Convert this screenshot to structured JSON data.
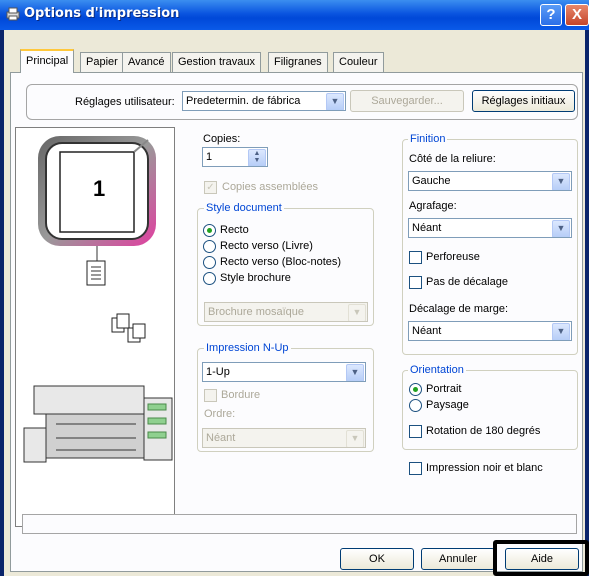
{
  "window": {
    "title": "Options d'impression",
    "help_glyph": "?",
    "close_glyph": "X"
  },
  "tabs": [
    "Principal",
    "Papier",
    "Avancé",
    "Gestion travaux",
    "Filigranes",
    "Couleur"
  ],
  "user_settings": {
    "label": "Réglages utilisateur:",
    "value": "Predetermin. de fábrica",
    "save_button": "Sauvegarder...",
    "reset_button": "Réglages initiaux"
  },
  "preview": {
    "page_number": "1"
  },
  "copies": {
    "label": "Copies:",
    "value": "1",
    "collate_label": "Copies assemblées",
    "collate_checked": true
  },
  "document_style": {
    "legend": "Style document",
    "options": [
      "Recto",
      "Recto verso (Livre)",
      "Recto verso (Bloc-notes)",
      "Style brochure"
    ],
    "selected": "Recto",
    "brochure_value": "Brochure mosaïque"
  },
  "nup": {
    "legend": "Impression N-Up",
    "value": "1-Up",
    "border_label": "Bordure",
    "order_label": "Ordre:",
    "order_value": "Néant"
  },
  "finishing": {
    "legend": "Finition",
    "binding_label": "Côté de la reliure:",
    "binding_value": "Gauche",
    "staple_label": "Agrafage:",
    "staple_value": "Néant",
    "punch_label": "Perforeuse",
    "offset_label": "Pas de décalage",
    "margin_label": "Décalage de marge:",
    "margin_value": "Néant"
  },
  "orientation": {
    "legend": "Orientation",
    "options": [
      "Portrait",
      "Paysage"
    ],
    "selected": "Portrait",
    "rotate_label": "Rotation de 180 degrés"
  },
  "bw_label": "Impression noir et blanc",
  "buttons": {
    "ok": "OK",
    "cancel": "Annuler",
    "help": "Aide"
  },
  "colors": {
    "titlebar": "#0054e3",
    "accent_legend": "#0046d5",
    "panel": "#fcfcfe",
    "dialog": "#ece9d8"
  }
}
